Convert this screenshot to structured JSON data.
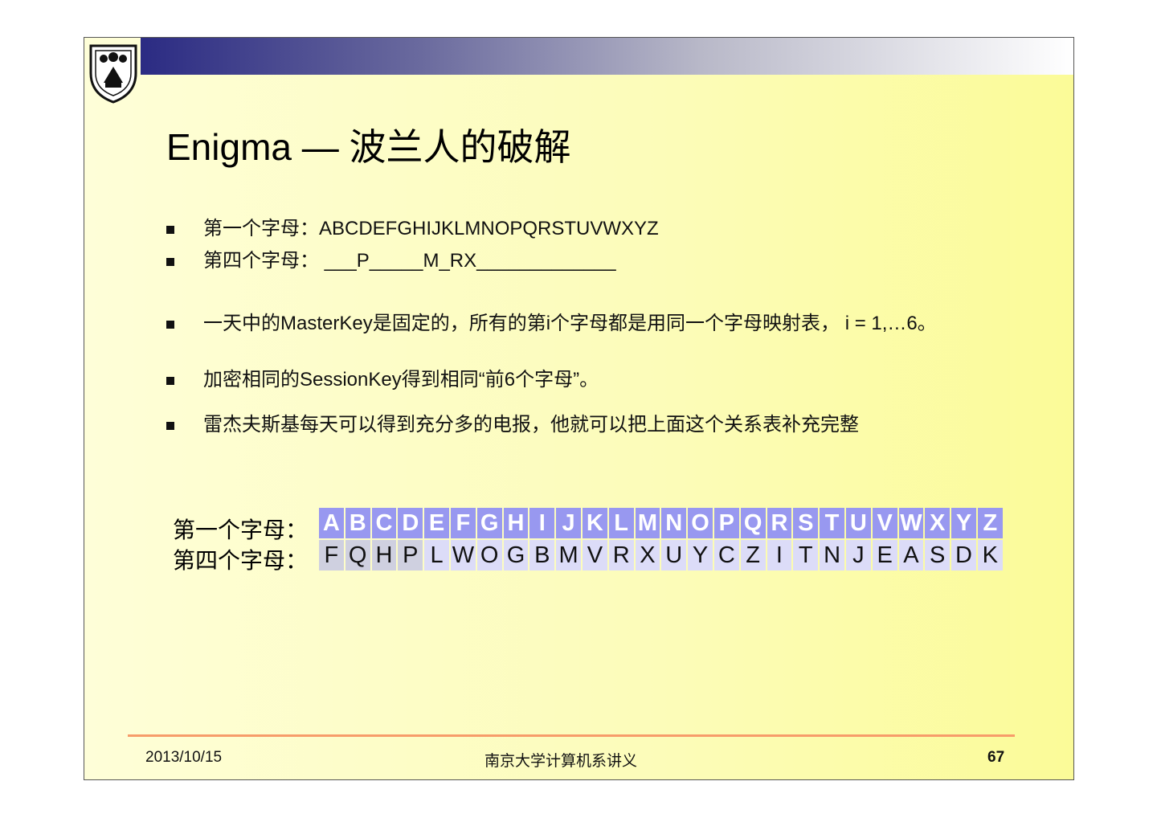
{
  "title": "Enigma — 波兰人的破解",
  "bullets": [
    "第一个字母：ABCDEFGHIJKLMNOPQRSTUVWXYZ",
    "第四个字母：   ___P_____M_RX_____________",
    "一天中的MasterKey是固定的，所有的第i个字母都是用同一个字母映射表， i = 1,…6。",
    "加密相同的SessionKey得到相同“前6个字母”。",
    "雷杰夫斯基每天可以得到充分多的电报，他就可以把上面这个关系表补充完整"
  ],
  "table": {
    "label1": "第一个字母：",
    "label2": "第四个字母：",
    "first": [
      "A",
      "B",
      "C",
      "D",
      "E",
      "F",
      "G",
      "H",
      "I",
      "J",
      "K",
      "L",
      "M",
      "N",
      "O",
      "P",
      "Q",
      "R",
      "S",
      "T",
      "U",
      "V",
      "W",
      "X",
      "Y",
      "Z"
    ],
    "fourth": [
      "F",
      "Q",
      "H",
      "P",
      "L",
      "W",
      "O",
      "G",
      "B",
      "M",
      "V",
      "R",
      "X",
      "U",
      "Y",
      "C",
      "Z",
      "I",
      "T",
      "N",
      "J",
      "E",
      "A",
      "S",
      "D",
      "K"
    ]
  },
  "footer": {
    "date": "2013/10/15",
    "center": "南京大学计算机系讲义",
    "page": "67"
  }
}
